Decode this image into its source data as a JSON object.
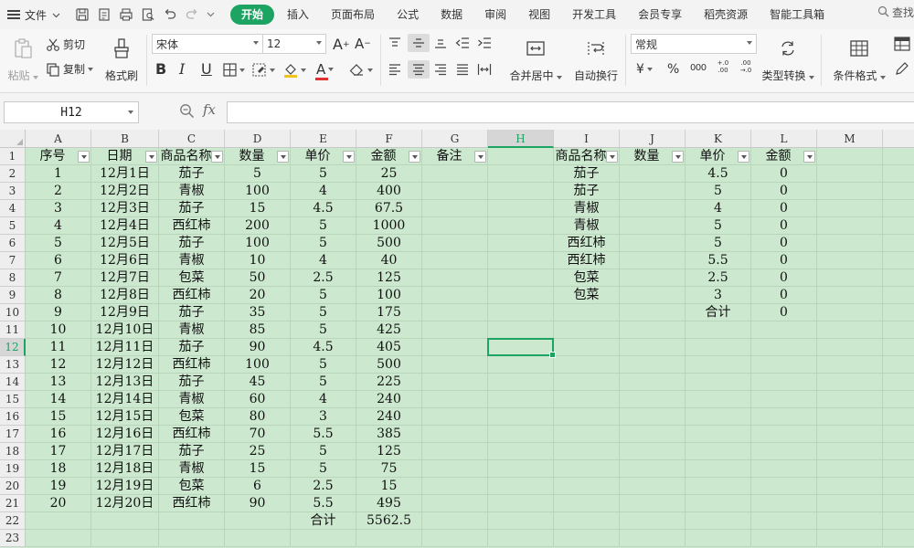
{
  "menubar": {
    "file_label": "文件",
    "tabs": [
      "开始",
      "插入",
      "页面布局",
      "公式",
      "数据",
      "审阅",
      "视图",
      "开发工具",
      "会员专享",
      "稻壳资源",
      "智能工具箱"
    ],
    "active_tab": "开始",
    "search_label": "查找"
  },
  "ribbon": {
    "paste": "粘贴",
    "cut": "剪切",
    "copy": "复制",
    "format_painter": "格式刷",
    "font_name": "宋体",
    "font_size": "12",
    "bold": "B",
    "italic": "I",
    "underline": "U",
    "font_color_letter": "A",
    "merge_center": "合并居中",
    "wrap_text": "自动换行",
    "number_format": "常规",
    "currency_symbol": "¥",
    "percent_symbol": "%",
    "thousands": "000",
    "inc_decimal": "+.0 .00",
    "dec_decimal": ".00 →.0",
    "type_convert": "类型转换",
    "conditional_format": "条件格式"
  },
  "formula_bar": {
    "name_box": "H12",
    "fx": "fx",
    "formula": ""
  },
  "sheet": {
    "columns": [
      "A",
      "B",
      "C",
      "D",
      "E",
      "F",
      "G",
      "H",
      "I",
      "J",
      "K",
      "L",
      "M"
    ],
    "selected_column": "H",
    "selected_row": "12",
    "rows": [
      [
        "序号",
        "日期",
        "商品名称",
        "数量",
        "单价",
        "金额",
        "备注",
        "",
        "商品名称",
        "数量",
        "单价",
        "金额",
        ""
      ],
      [
        "1",
        "12月1日",
        "茄子",
        "5",
        "5",
        "25",
        "",
        "",
        "茄子",
        "",
        "4.5",
        "0",
        ""
      ],
      [
        "2",
        "12月2日",
        "青椒",
        "100",
        "4",
        "400",
        "",
        "",
        "茄子",
        "",
        "5",
        "0",
        ""
      ],
      [
        "3",
        "12月3日",
        "茄子",
        "15",
        "4.5",
        "67.5",
        "",
        "",
        "青椒",
        "",
        "4",
        "0",
        ""
      ],
      [
        "4",
        "12月4日",
        "西红柿",
        "200",
        "5",
        "1000",
        "",
        "",
        "青椒",
        "",
        "5",
        "0",
        ""
      ],
      [
        "5",
        "12月5日",
        "茄子",
        "100",
        "5",
        "500",
        "",
        "",
        "西红柿",
        "",
        "5",
        "0",
        ""
      ],
      [
        "6",
        "12月6日",
        "青椒",
        "10",
        "4",
        "40",
        "",
        "",
        "西红柿",
        "",
        "5.5",
        "0",
        ""
      ],
      [
        "7",
        "12月7日",
        "包菜",
        "50",
        "2.5",
        "125",
        "",
        "",
        "包菜",
        "",
        "2.5",
        "0",
        ""
      ],
      [
        "8",
        "12月8日",
        "西红柿",
        "20",
        "5",
        "100",
        "",
        "",
        "包菜",
        "",
        "3",
        "0",
        ""
      ],
      [
        "9",
        "12月9日",
        "茄子",
        "35",
        "5",
        "175",
        "",
        "",
        "",
        "",
        "合计",
        "0",
        ""
      ],
      [
        "10",
        "12月10日",
        "青椒",
        "85",
        "5",
        "425",
        "",
        "",
        "",
        "",
        "",
        "",
        ""
      ],
      [
        "11",
        "12月11日",
        "茄子",
        "90",
        "4.5",
        "405",
        "",
        "",
        "",
        "",
        "",
        "",
        ""
      ],
      [
        "12",
        "12月12日",
        "西红柿",
        "100",
        "5",
        "500",
        "",
        "",
        "",
        "",
        "",
        "",
        ""
      ],
      [
        "13",
        "12月13日",
        "茄子",
        "45",
        "5",
        "225",
        "",
        "",
        "",
        "",
        "",
        "",
        ""
      ],
      [
        "14",
        "12月14日",
        "青椒",
        "60",
        "4",
        "240",
        "",
        "",
        "",
        "",
        "",
        "",
        ""
      ],
      [
        "15",
        "12月15日",
        "包菜",
        "80",
        "3",
        "240",
        "",
        "",
        "",
        "",
        "",
        "",
        ""
      ],
      [
        "16",
        "12月16日",
        "西红柿",
        "70",
        "5.5",
        "385",
        "",
        "",
        "",
        "",
        "",
        "",
        ""
      ],
      [
        "17",
        "12月17日",
        "茄子",
        "25",
        "5",
        "125",
        "",
        "",
        "",
        "",
        "",
        "",
        ""
      ],
      [
        "18",
        "12月18日",
        "青椒",
        "15",
        "5",
        "75",
        "",
        "",
        "",
        "",
        "",
        "",
        ""
      ],
      [
        "19",
        "12月19日",
        "包菜",
        "6",
        "2.5",
        "15",
        "",
        "",
        "",
        "",
        "",
        "",
        ""
      ],
      [
        "20",
        "12月20日",
        "西红柿",
        "90",
        "5.5",
        "495",
        "",
        "",
        "",
        "",
        "",
        "",
        ""
      ],
      [
        "",
        "",
        "",
        "",
        "合计",
        "5562.5",
        "",
        "",
        "",
        "",
        "",
        "",
        ""
      ],
      [
        "",
        "",
        "",
        "",
        "",
        "",
        "",
        "",
        "",
        "",
        "",
        "",
        ""
      ]
    ],
    "filter_columns": [
      0,
      1,
      2,
      3,
      4,
      5,
      6,
      8,
      9,
      10,
      11
    ]
  },
  "colors": {
    "accent": "#1da463",
    "grid_fill": "#cce8cf"
  }
}
